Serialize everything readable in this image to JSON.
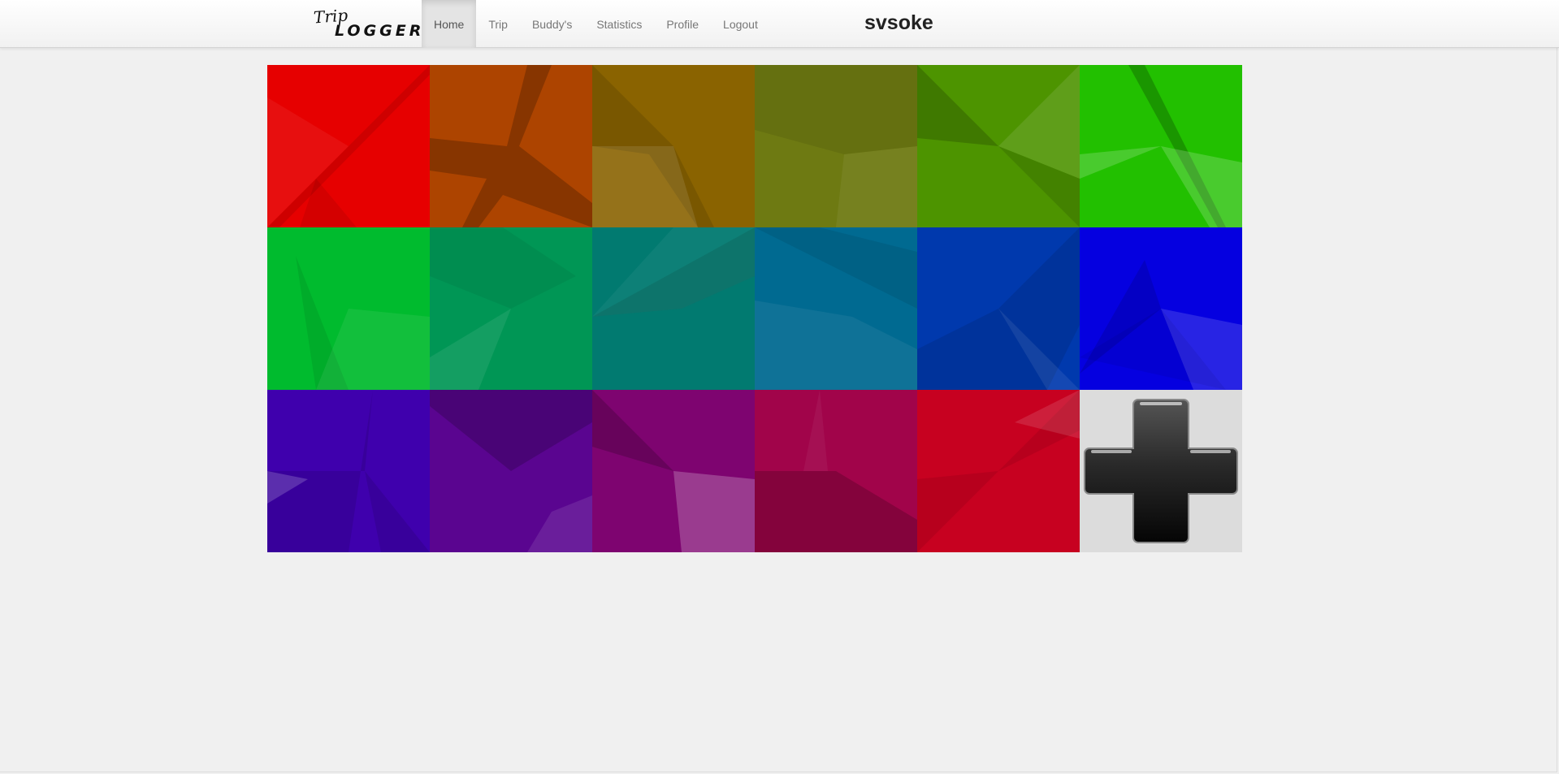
{
  "brand": {
    "line1": "Trip",
    "line2": "LOGGER"
  },
  "nav": {
    "items": [
      {
        "label": "Home",
        "active": true
      },
      {
        "label": "Trip",
        "active": false
      },
      {
        "label": "Buddy's",
        "active": false
      },
      {
        "label": "Statistics",
        "active": false
      },
      {
        "label": "Profile",
        "active": false
      },
      {
        "label": "Logout",
        "active": false
      }
    ]
  },
  "user": {
    "name": "svsoke"
  },
  "tiles": [
    {
      "color": "#e60000"
    },
    {
      "color": "#ad4400"
    },
    {
      "color": "#8a6300"
    },
    {
      "color": "#6e7a12"
    },
    {
      "color": "#4d9400"
    },
    {
      "color": "#22c000"
    },
    {
      "color": "#00bb2e"
    },
    {
      "color": "#009655"
    },
    {
      "color": "#017a70"
    },
    {
      "color": "#006a91"
    },
    {
      "color": "#0039ad"
    },
    {
      "color": "#0500e0"
    },
    {
      "color": "#3f00ad"
    },
    {
      "color": "#5a0590"
    },
    {
      "color": "#7e0470"
    },
    {
      "color": "#a1044a"
    },
    {
      "color": "#c70120"
    }
  ],
  "add_tile": {
    "icon": "plus-icon",
    "background": "#dcdcdc"
  }
}
